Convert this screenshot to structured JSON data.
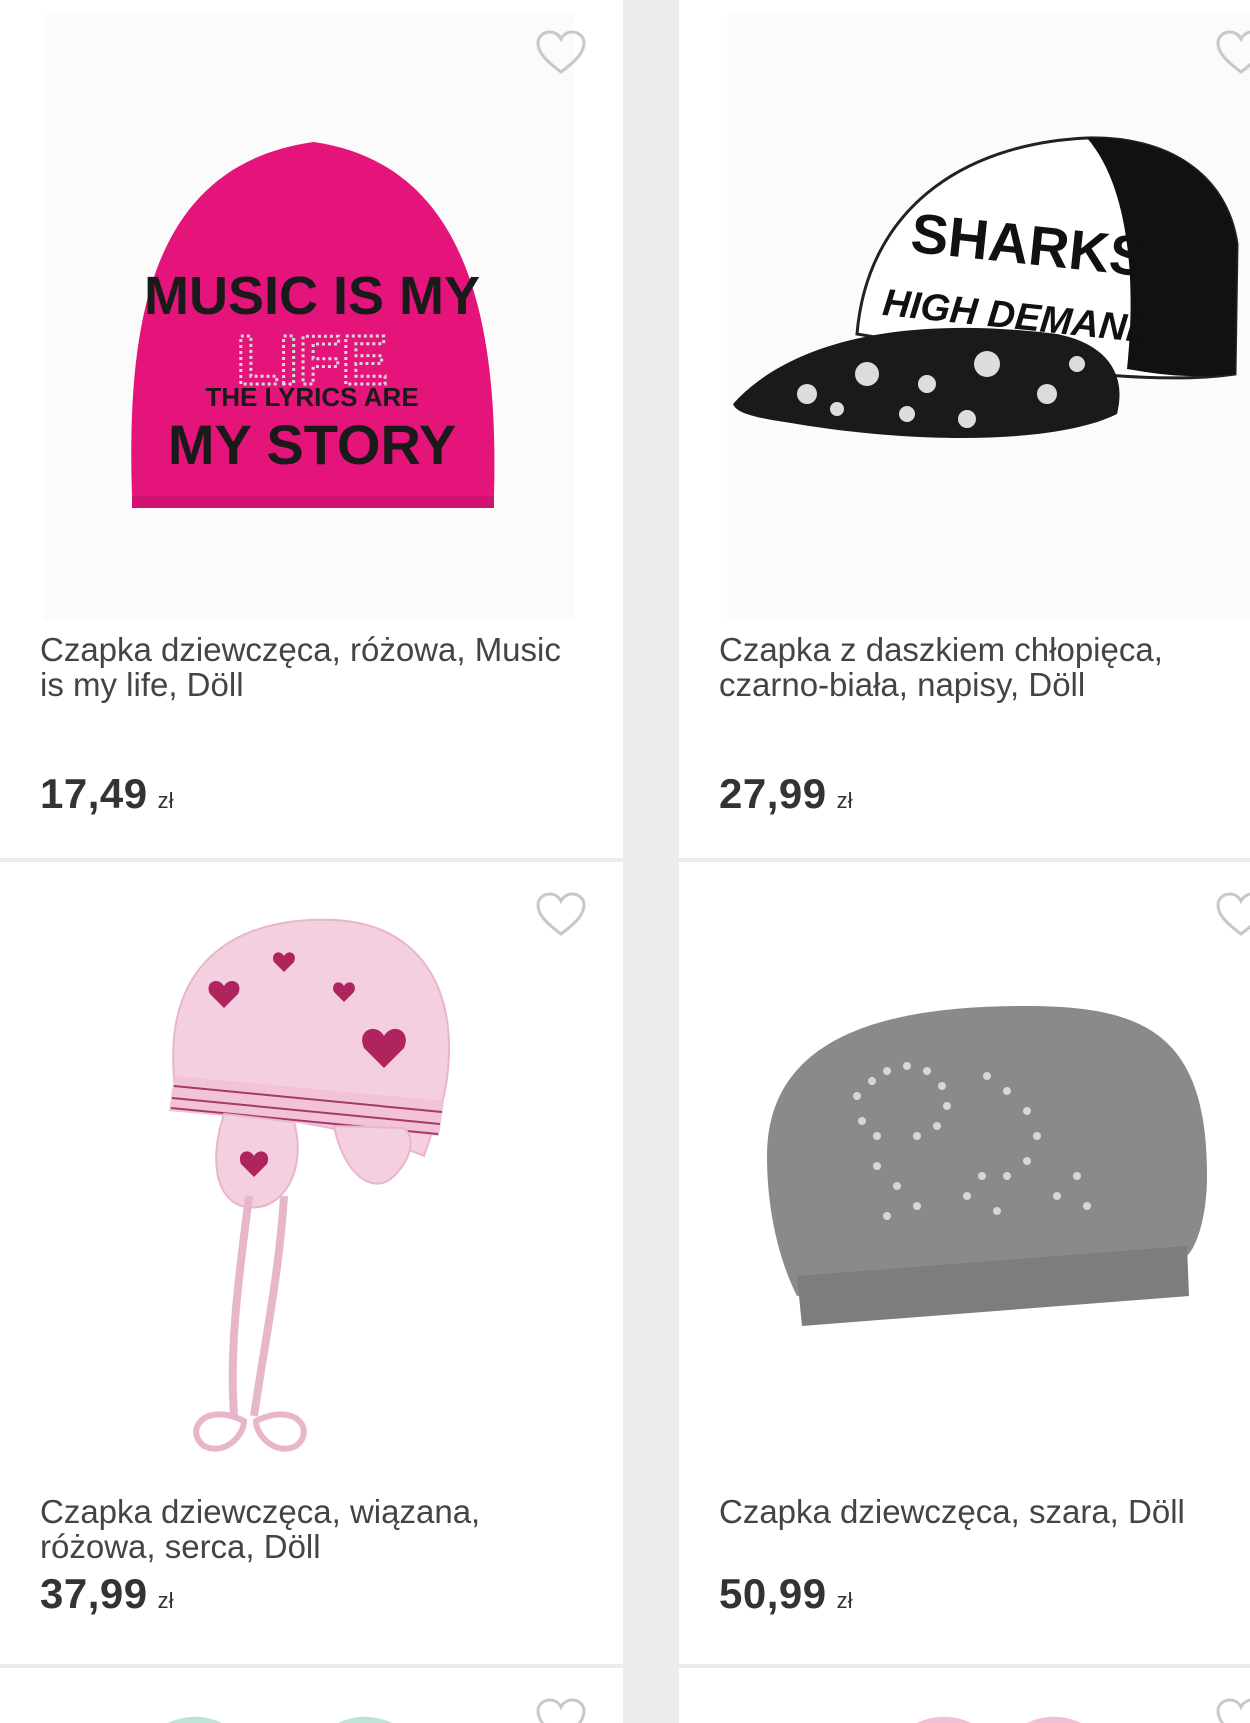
{
  "products": [
    {
      "title": "Czapka dziewczęca, różowa, Music is my life, Döll",
      "price": "17,49",
      "currency": "zł",
      "print_lines": [
        "MUSIC IS MY",
        "LIFE",
        "THE LYRICS ARE",
        "MY STORY"
      ]
    },
    {
      "title": "Czapka z daszkiem chłopięca, czarno-biała, napisy, Döll",
      "price": "27,99",
      "currency": "zł",
      "print_lines": [
        "SHARKS",
        "HIGH DEMAND"
      ]
    },
    {
      "title": "Czapka dziewczęca, wiązana, różowa, serca, Döll",
      "price": "37,99",
      "currency": "zł"
    },
    {
      "title": "Czapka dziewczęca, szara, Döll",
      "price": "50,99",
      "currency": "zł"
    }
  ],
  "icons": {
    "favorite": "heart-outline-icon"
  },
  "colors": {
    "heart": "#c8c8c8",
    "pink_hat": "#e5147a",
    "grey_hat": "#8a8a8a"
  }
}
